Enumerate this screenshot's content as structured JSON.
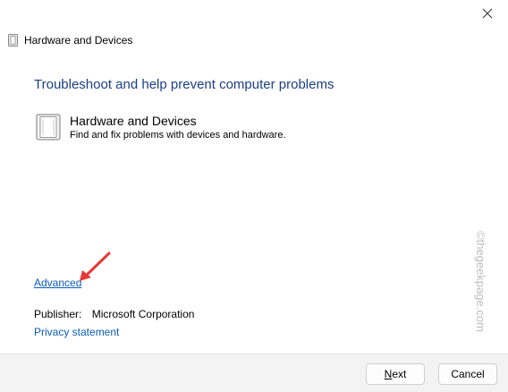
{
  "window": {
    "title": "Hardware and Devices",
    "close_icon": "close-icon"
  },
  "content": {
    "heading": "Troubleshoot and help prevent computer problems",
    "item": {
      "icon": "hardware-device-icon",
      "title": "Hardware and Devices",
      "description": "Find and fix problems with devices and hardware."
    },
    "advanced_link": "Advanced",
    "publisher_label": "Publisher:",
    "publisher_value": "Microsoft Corporation",
    "privacy_link": "Privacy statement",
    "watermark": "©thegeekpage.com"
  },
  "footer": {
    "next_label": "Next",
    "cancel_label": "Cancel"
  },
  "colors": {
    "heading": "#1a3f86",
    "link": "#0b5cb8",
    "annotation_arrow": "#e53935"
  }
}
